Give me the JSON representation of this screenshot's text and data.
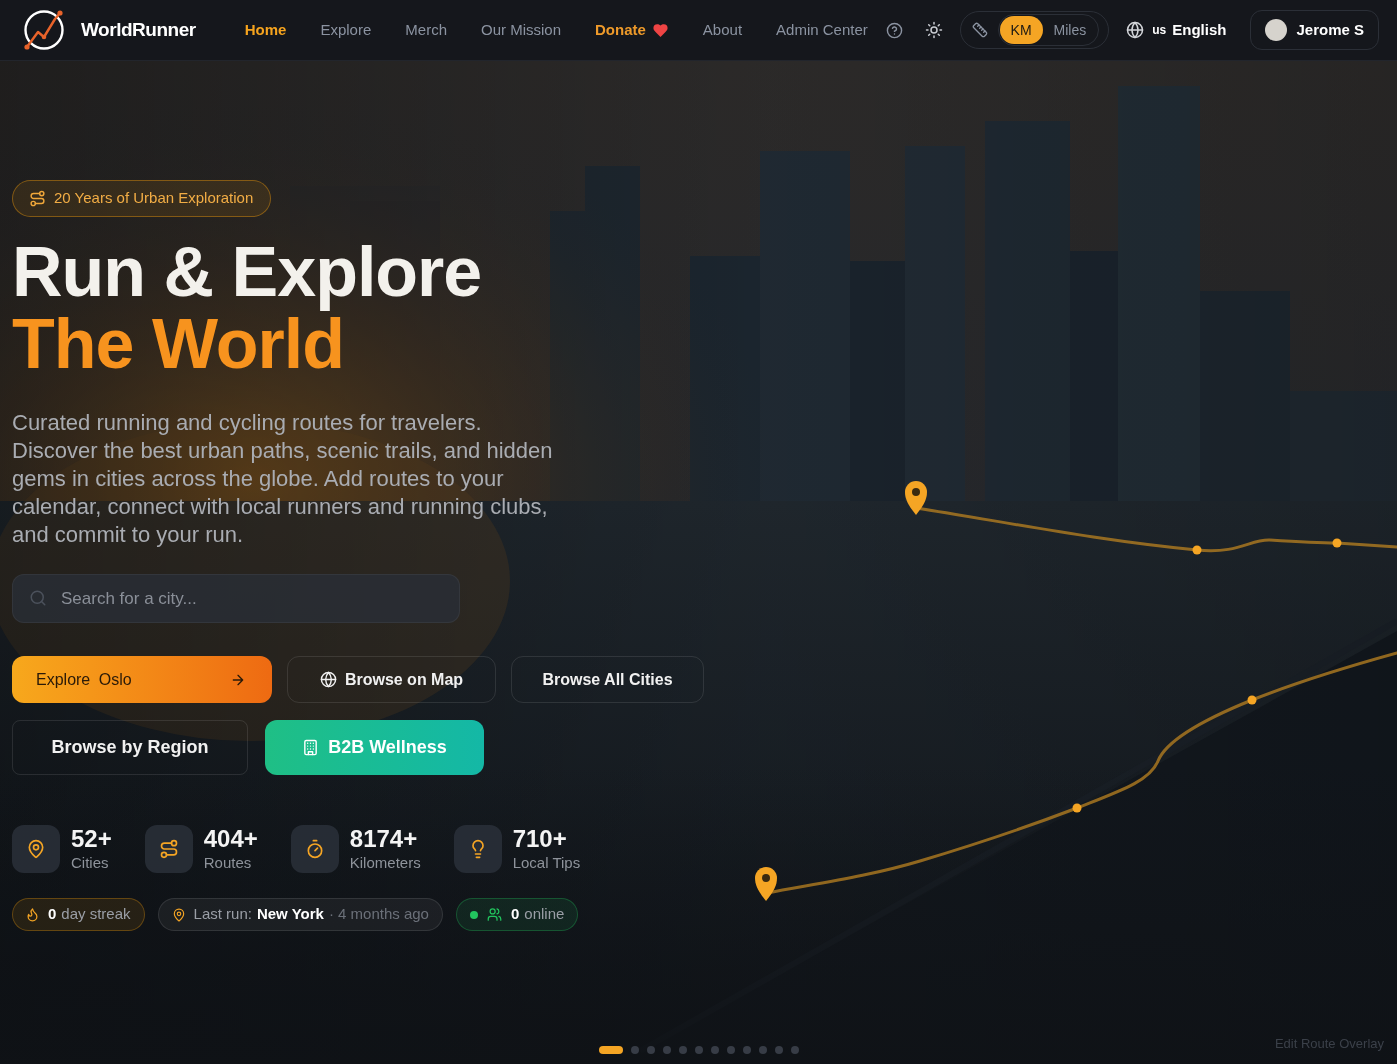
{
  "nav": {
    "brand": "WorldRunner",
    "links": [
      {
        "label": "Home",
        "kind": "link",
        "selected": true
      },
      {
        "label": "Explore",
        "kind": "link",
        "selected": false
      },
      {
        "label": "Merch",
        "kind": "link",
        "selected": false
      },
      {
        "label": "Our Mission",
        "kind": "link",
        "selected": false
      },
      {
        "label": "Donate",
        "kind": "donate",
        "selected": false
      },
      {
        "label": "About",
        "kind": "link",
        "selected": false
      },
      {
        "label": "Admin Center",
        "kind": "link",
        "selected": false
      }
    ],
    "units": [
      {
        "label": "KM",
        "selected": true
      },
      {
        "label": "Miles",
        "selected": false
      }
    ],
    "language": {
      "region": "us",
      "label": "English"
    },
    "user": {
      "name": "Jerome S"
    }
  },
  "hero": {
    "badge": "20 Years of Urban Exploration",
    "title_line_1": "Run & Explore",
    "title_line_2": "The World",
    "description": "Curated running and cycling routes for travelers. Discover the best urban paths, scenic trails, and hidden gems in cities across the globe. Add routes to your calendar, connect with local runners and running clubs, and commit to your run.",
    "search": {
      "placeholder": "Search for a city..."
    }
  },
  "action_rows": [
    [
      {
        "kind": "primary",
        "label": "Explore Oslo"
      },
      {
        "kind": "map",
        "label": "Browse on Map"
      },
      {
        "kind": "secondary",
        "label": "Browse All Cities"
      }
    ],
    [
      {
        "kind": "region",
        "label": "Browse by Region"
      },
      {
        "kind": "accent",
        "label": "B2B Wellness"
      }
    ]
  ],
  "stats": [
    {
      "value": "52+",
      "label": "Cities"
    },
    {
      "value": "404+",
      "label": "Routes"
    },
    {
      "value": "8174+",
      "label": "Kilometers"
    },
    {
      "value": "710+",
      "label": "Local Tips"
    }
  ],
  "activity": {
    "streak": {
      "count": "0",
      "label": "day streak"
    },
    "last_run": {
      "label": "Last run:",
      "city": "New York",
      "ago": "· 4 months ago"
    },
    "online": {
      "count": "0",
      "label": "online"
    }
  },
  "carousel": {
    "slides": [
      {
        "selected": true
      },
      {
        "selected": false
      },
      {
        "selected": false
      },
      {
        "selected": false
      },
      {
        "selected": false
      },
      {
        "selected": false
      },
      {
        "selected": false
      },
      {
        "selected": false
      },
      {
        "selected": false
      },
      {
        "selected": false
      },
      {
        "selected": false
      },
      {
        "selected": false
      }
    ]
  },
  "footer_link": "Edit Route Overlay"
}
